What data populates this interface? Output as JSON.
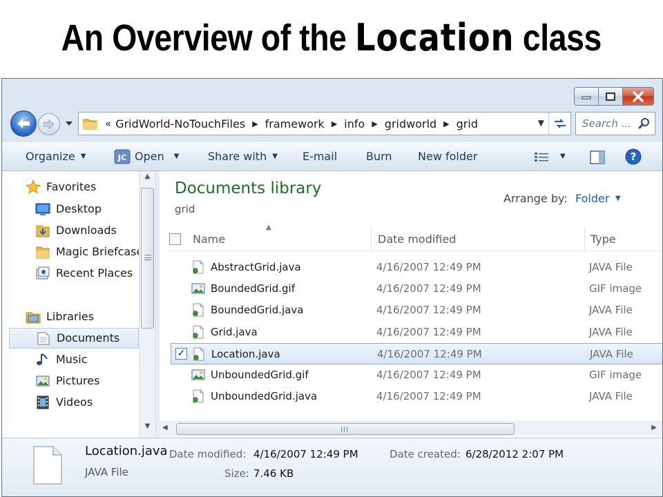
{
  "slide": {
    "title_part1": "An Overview of the ",
    "title_part2": "Location",
    "title_part3": " class"
  },
  "window": {
    "caption_buttons": [
      "minimize-icon",
      "maximize-icon",
      "close-icon"
    ]
  },
  "address": {
    "overflow_chevron": "«",
    "crumbs": [
      "GridWorld-NoTouchFiles",
      "framework",
      "info",
      "gridworld",
      "grid"
    ]
  },
  "search": {
    "placeholder": "Search ..."
  },
  "toolbar": {
    "organize": "Organize",
    "open": "Open",
    "share_with": "Share with",
    "email": "E-mail",
    "burn": "Burn",
    "new_folder": "New folder"
  },
  "nav": {
    "favorites": "Favorites",
    "desktop": "Desktop",
    "downloads": "Downloads",
    "magic_briefcase": "Magic Briefcase",
    "recent_places": "Recent Places",
    "libraries": "Libraries",
    "documents": "Documents",
    "music": "Music",
    "pictures": "Pictures",
    "videos": "Videos"
  },
  "library": {
    "title": "Documents library",
    "subtitle": "grid",
    "arrange_label": "Arrange by:",
    "arrange_value": "Folder"
  },
  "columns": {
    "name": "Name",
    "date_modified": "Date modified",
    "type": "Type"
  },
  "files": [
    {
      "name": "AbstractGrid.java",
      "date": "4/16/2007 12:49 PM",
      "type": "JAVA File",
      "kind": "java"
    },
    {
      "name": "BoundedGrid.gif",
      "date": "4/16/2007 12:49 PM",
      "type": "GIF image",
      "kind": "gif"
    },
    {
      "name": "BoundedGrid.java",
      "date": "4/16/2007 12:49 PM",
      "type": "JAVA File",
      "kind": "java"
    },
    {
      "name": "Grid.java",
      "date": "4/16/2007 12:49 PM",
      "type": "JAVA File",
      "kind": "java"
    },
    {
      "name": "Location.java",
      "date": "4/16/2007 12:49 PM",
      "type": "JAVA File",
      "kind": "java",
      "selected": true
    },
    {
      "name": "UnboundedGrid.gif",
      "date": "4/16/2007 12:49 PM",
      "type": "GIF image",
      "kind": "gif"
    },
    {
      "name": "UnboundedGrid.java",
      "date": "4/16/2007 12:49 PM",
      "type": "JAVA File",
      "kind": "java"
    }
  ],
  "details": {
    "name": "Location.java",
    "type": "JAVA File",
    "date_modified_label": "Date modified:",
    "date_modified": "4/16/2007 12:49 PM",
    "date_created_label": "Date created:",
    "date_created": "6/28/2012 2:07 PM",
    "size_label": "Size:",
    "size": "7.46 KB"
  },
  "colors": {
    "library_title": "#1e6f22",
    "link_blue": "#1c5dbf",
    "toolbar_text": "#1e395b",
    "selection_border": "#84acdd"
  }
}
